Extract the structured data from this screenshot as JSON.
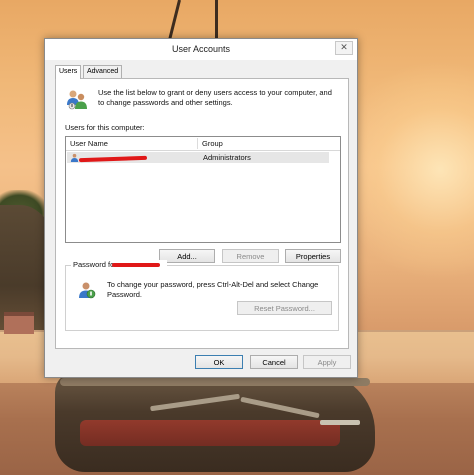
{
  "window": {
    "title": "User Accounts",
    "close_glyph": "✕"
  },
  "tabs": [
    {
      "label": "Users",
      "active": true
    },
    {
      "label": "Advanced",
      "active": false
    }
  ],
  "intro_text": "Use the list below to grant or deny users access to your computer, and to change passwords and other settings.",
  "users_list": {
    "label": "Users for this computer:",
    "columns": [
      "User Name",
      "Group"
    ],
    "rows": [
      {
        "name": "",
        "group": "Administrators",
        "selected": true,
        "name_redacted": true
      }
    ]
  },
  "list_buttons": {
    "add": "Add...",
    "remove": "Remove",
    "properties": "Properties"
  },
  "password_group": {
    "title": "Password for ",
    "title_name_redacted": true,
    "text": "To change your password, press Ctrl-Alt-Del and select Change Password.",
    "reset_button": "Reset Password..."
  },
  "dialog_buttons": {
    "ok": "OK",
    "cancel": "Cancel",
    "apply": "Apply"
  },
  "icons": {
    "users": "users-icon",
    "password": "password-user-icon",
    "close": "close-icon",
    "row_user": "user-icon"
  },
  "colors": {
    "redaction": "#e01818",
    "selected_row": "#e6e6e6"
  }
}
